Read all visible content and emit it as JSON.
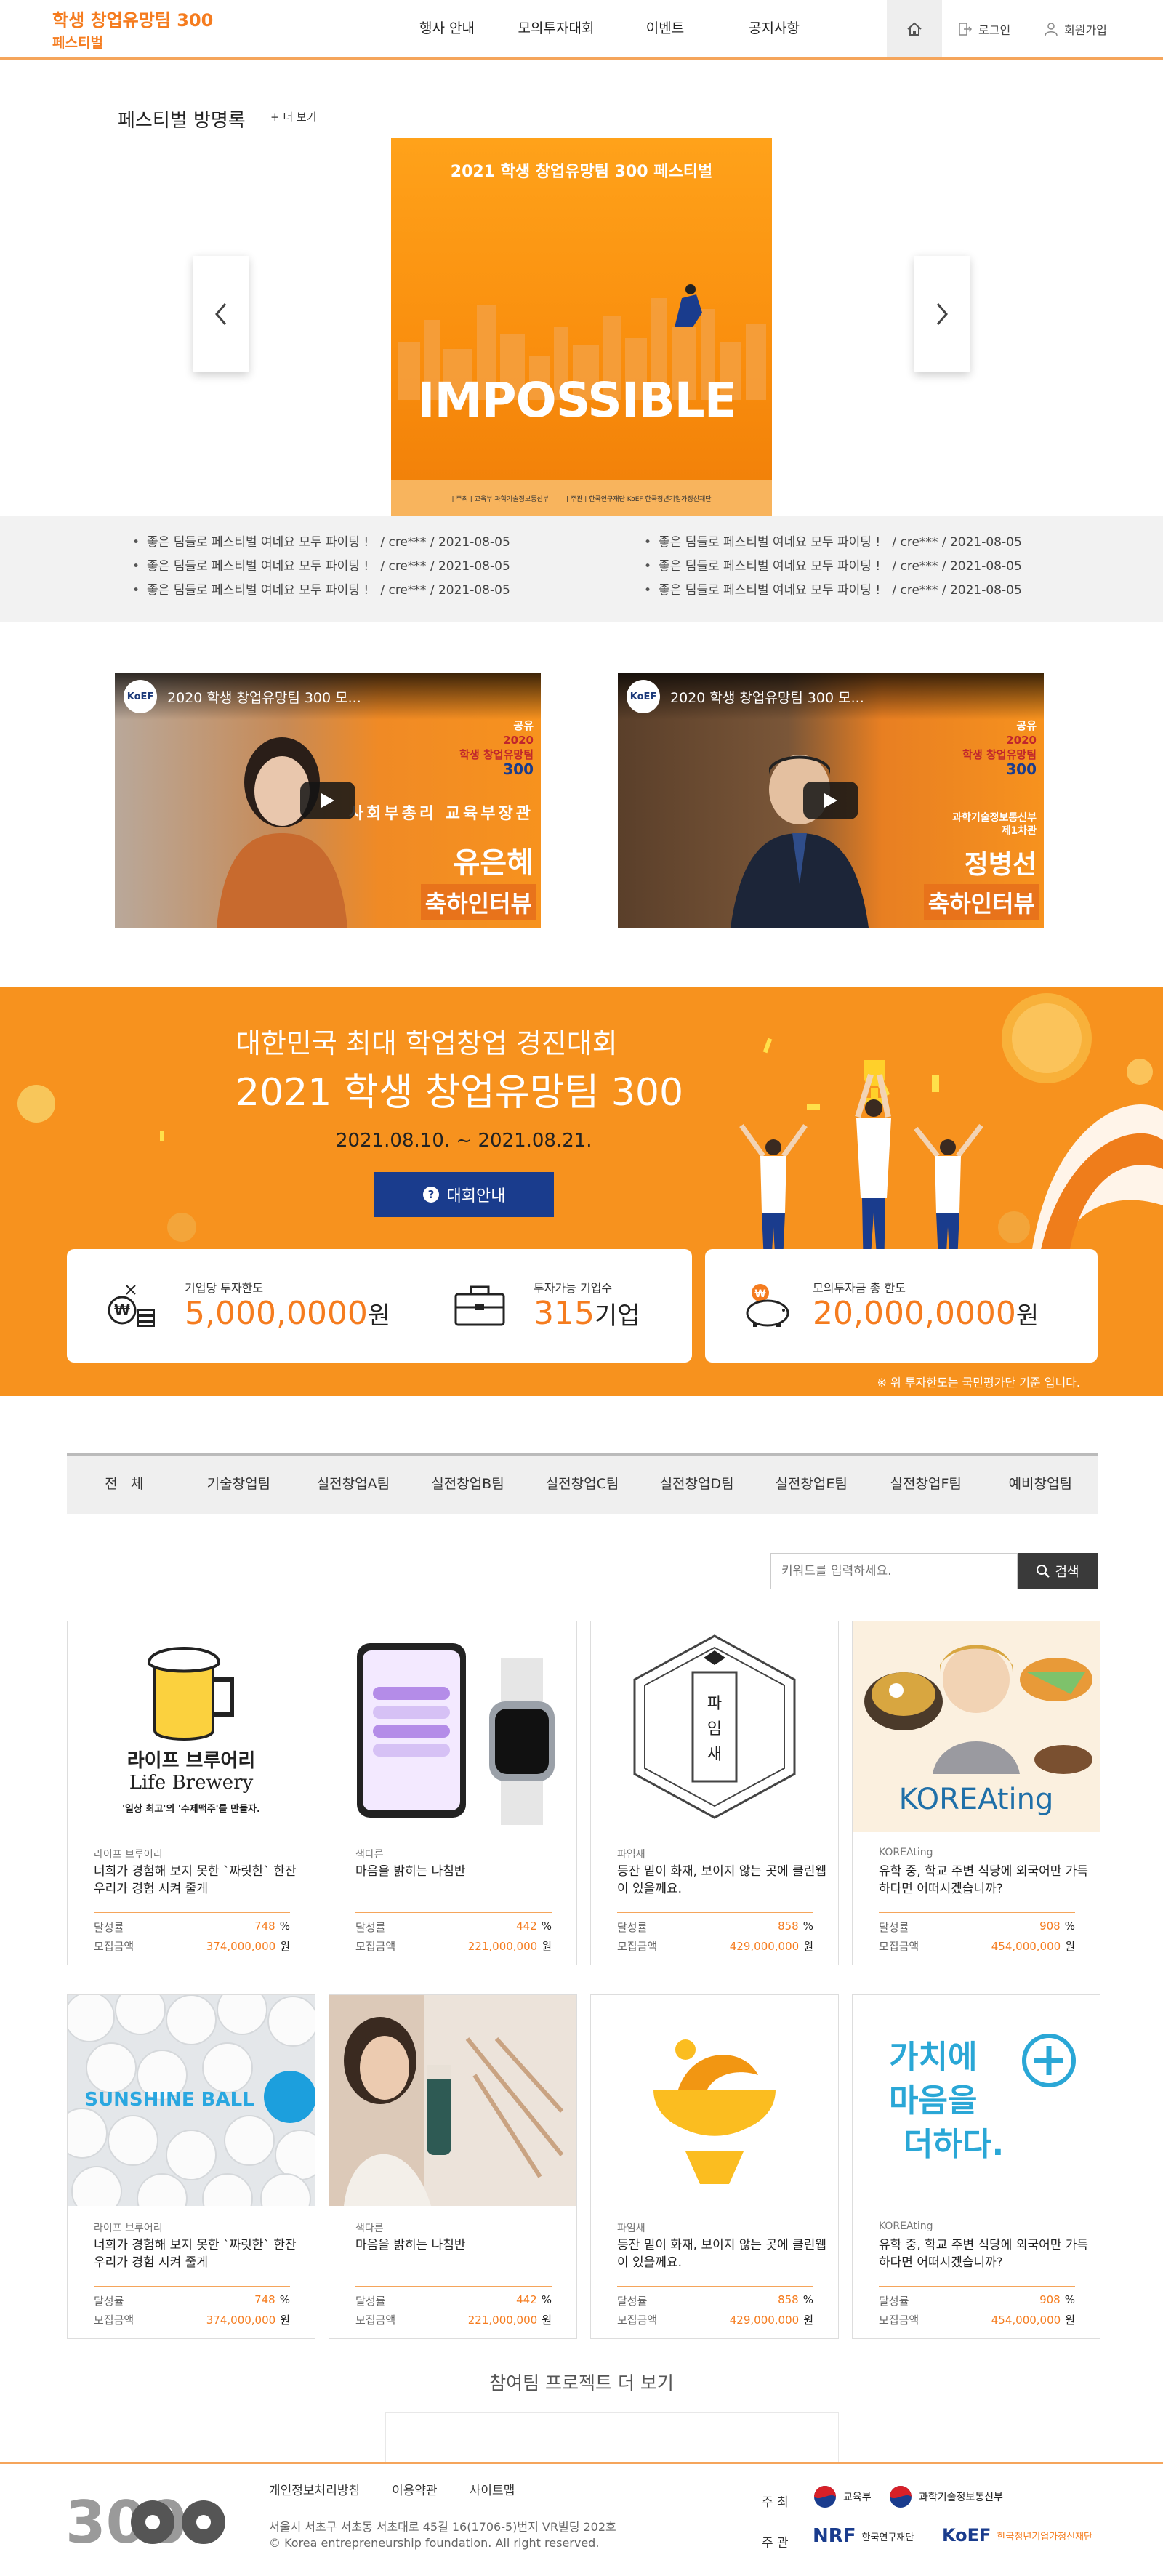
{
  "header": {
    "logo_title": "학생 창업유망팀 300",
    "logo_subtitle": "페스티벌",
    "nav": [
      "행사 안내",
      "모의투자대회",
      "이벤트",
      "공지사항"
    ],
    "login": "로그인",
    "signup": "회원가입"
  },
  "guestbook": {
    "title": "페스티벌 방명록",
    "more": "+ 더 보기",
    "poster": {
      "title": "2021 학생 창업유망팀 300 페스티벌",
      "headline": "IMPOSSIBLE",
      "host_label": "| 주최 |",
      "host_org": "교육부",
      "host_org2": "과학기술정보통신부",
      "manage_label": "| 주관 |",
      "manage_org": "한국연구재단",
      "manage_org2": "KoEF 한국청년기업가정신재단"
    },
    "entries_left": [
      {
        "text": "좋은 팀들로 페스티벌 여네요 모두 파이팅 !",
        "meta": "/ cre*** / 2021-08-05"
      },
      {
        "text": "좋은 팀들로 페스티벌 여네요 모두 파이팅 !",
        "meta": "/ cre*** / 2021-08-05"
      },
      {
        "text": "좋은 팀들로 페스티벌 여네요 모두 파이팅 !",
        "meta": "/ cre*** / 2021-08-05"
      }
    ],
    "entries_right": [
      {
        "text": "좋은 팀들로 페스티벌 여네요 모두 파이팅 !",
        "meta": "/ cre*** / 2021-08-05"
      },
      {
        "text": "좋은 팀들로 페스티벌 여네요 모두 파이팅 !",
        "meta": "/ cre*** / 2021-08-05"
      },
      {
        "text": "좋은 팀들로 페스티벌 여네요 모두 파이팅 !",
        "meta": "/ cre*** / 2021-08-05"
      }
    ]
  },
  "videos": [
    {
      "logo": "KoEF",
      "title": "2020 학생 창업유망팀 300 모...",
      "badge1": "공유",
      "badge2": "2020",
      "badge3": "학생 창업유망팀",
      "badge4": "300",
      "role": "사회부총리 교육부장관",
      "name": "유은혜",
      "tag": "축하인터뷰"
    },
    {
      "logo": "KoEF",
      "title": "2020 학생 창업유망팀 300 모...",
      "badge1": "공유",
      "badge2": "2020",
      "badge3": "학생 창업유망팀",
      "badge4": "300",
      "role": "과학기술정보통신부 제1차관",
      "name": "정병선",
      "tag": "축하인터뷰"
    }
  ],
  "banner": {
    "line1": "대한민국 최대 학업창업 경진대회",
    "line2": "2021 학생 창업유망팀 300",
    "date": "2021.08.10. ~ 2021.08.21.",
    "button": "대회안내",
    "stats": [
      {
        "label": "기업당 투자한도",
        "value": "5,000,0000",
        "unit": "원"
      },
      {
        "label": "투자가능 기업수",
        "value": "315",
        "unit": "기업"
      },
      {
        "label": "모의투자금 총 한도",
        "value": "20,000,0000",
        "unit": "원"
      }
    ],
    "note": "※ 위 투자한도는 국민평가단 기준 입니다."
  },
  "tabs": [
    "전   체",
    "기술창업팀",
    "실전창업A팀",
    "실전창업B팀",
    "실전창업C팀",
    "실전창업D팀",
    "실전창업E팀",
    "실전창업F팀",
    "예비창업팀"
  ],
  "search": {
    "placeholder": "키워드를 입력하세요.",
    "button": "검색"
  },
  "projects": [
    {
      "img_title": "라이프 브루어리",
      "img_sub": "Life Brewery",
      "img_tag": "'일상 최고'의 '수제맥주'를 만들자.",
      "category": "라이프 브루어리",
      "desc": "너희가 경험해 보지 못한 `짜릿한` 한잔 우리가 경험 시켜 줄게",
      "rate_label": "달성률",
      "rate": "748",
      "rate_unit": "%",
      "amt_label": "모집금액",
      "amount": "374,000,000",
      "amt_unit": "원"
    },
    {
      "img_title": "",
      "img_sub": "",
      "img_tag": "",
      "category": "색다른",
      "desc": "마음을 밝히는 나침반",
      "rate_label": "달성률",
      "rate": "442",
      "rate_unit": "%",
      "amt_label": "모집금액",
      "amount": "221,000,000",
      "amt_unit": "원"
    },
    {
      "img_title": "파임새",
      "img_sub": "",
      "img_tag": "",
      "category": "파임새",
      "desc": "등잔 밑이 화재, 보이지 않는 곳에 클린웹이 있을께요.",
      "rate_label": "달성률",
      "rate": "858",
      "rate_unit": "%",
      "amt_label": "모집금액",
      "amount": "429,000,000",
      "amt_unit": "원"
    },
    {
      "img_title": "KOREAting",
      "img_sub": "",
      "img_tag": "",
      "category": "KOREAting",
      "desc": "유학 중, 학교 주변 식당에 외국어만 가득하다면 어떠시겠습니까?",
      "rate_label": "달성률",
      "rate": "908",
      "rate_unit": "%",
      "amt_label": "모집금액",
      "amount": "454,000,000",
      "amt_unit": "원"
    },
    {
      "img_title": "SUNSHINE BALL",
      "img_sub": "",
      "img_tag": "",
      "category": "라이프 브루어리",
      "desc": "너희가 경험해 보지 못한 `짜릿한` 한잔 우리가 경험 시켜 줄게",
      "rate_label": "달성률",
      "rate": "748",
      "rate_unit": "%",
      "amt_label": "모집금액",
      "amount": "374,000,000",
      "amt_unit": "원"
    },
    {
      "img_title": "",
      "img_sub": "",
      "img_tag": "",
      "category": "색다른",
      "desc": "마음을 밝히는 나침반",
      "rate_label": "달성률",
      "rate": "442",
      "rate_unit": "%",
      "amt_label": "모집금액",
      "amount": "221,000,000",
      "amt_unit": "원"
    },
    {
      "img_title": "",
      "img_sub": "",
      "img_tag": "",
      "category": "파임새",
      "desc": "등잔 밑이 화재, 보이지 않는 곳에 클린웹이 있을께요.",
      "rate_label": "달성률",
      "rate": "858",
      "rate_unit": "%",
      "amt_label": "모집금액",
      "amount": "429,000,000",
      "amt_unit": "원"
    },
    {
      "img_title": "가치에 마음을 더하다.",
      "img_sub": "",
      "img_tag": "",
      "category": "KOREAting",
      "desc": "유학 중, 학교 주변 식당에 외국어만 가득하다면 어떠시겠습니까?",
      "rate_label": "달성률",
      "rate": "908",
      "rate_unit": "%",
      "amt_label": "모집금액",
      "amount": "454,000,000",
      "amt_unit": "원"
    }
  ],
  "more_projects": "참여팀 프로젝트 더 보기",
  "footer": {
    "logo": "300",
    "links": [
      "개인정보처리방침",
      "이용약관",
      "사이트맵"
    ],
    "address": "서울시 서초구 서초동 서초대로 45길 16(1706-5)번지 VR빌딩 202호",
    "copyright": "© Korea entrepreneurship foundation. All right reserved.",
    "host_label": "주 최",
    "host_orgs": [
      "교육부",
      "과학기술정보통신부"
    ],
    "manage_label": "주 관",
    "manage_orgs": [
      "한국연구재단",
      "한국청년기업가정신재단"
    ],
    "nrf": "NRF",
    "koef": "KoEF"
  },
  "colors": {
    "accent": "#f57c1f",
    "banner": "#f7921e",
    "button_navy": "#1a3c8d"
  }
}
